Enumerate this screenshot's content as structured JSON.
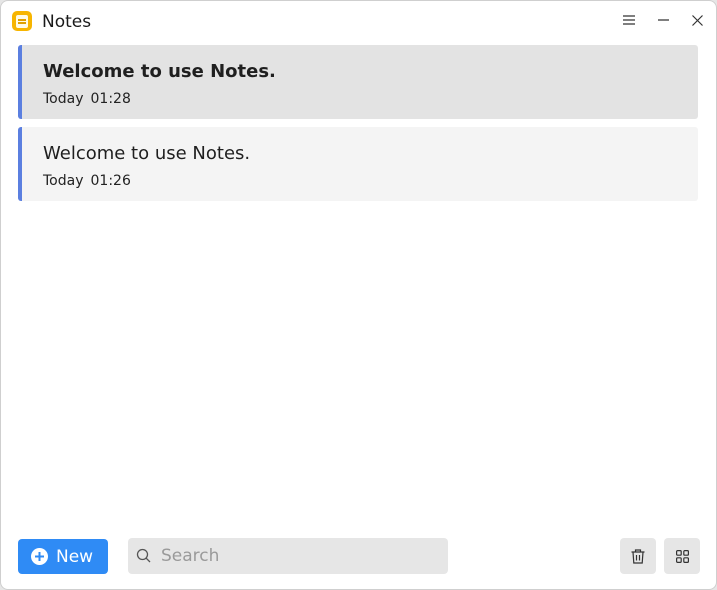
{
  "window": {
    "title": "Notes",
    "icons": {
      "app": "notes-app-icon",
      "menu": "hamburger-menu-icon",
      "minimize": "minimize-icon",
      "close": "close-icon"
    }
  },
  "notes": [
    {
      "title": "Welcome to use Notes.",
      "day": "Today",
      "time": "01:28",
      "selected": true
    },
    {
      "title": "Welcome to use Notes.",
      "day": "Today",
      "time": "01:26",
      "selected": false
    }
  ],
  "toolbar": {
    "new_label": "New",
    "new_icon": "plus-circle-icon",
    "search_placeholder": "Search",
    "search_value": "",
    "search_icon": "search-icon",
    "delete_icon": "trash-icon",
    "view_icon": "grid-view-icon"
  },
  "colors": {
    "accent": "#2f8bf5",
    "note_marker": "#5b7fe0",
    "app_icon": "#f7b500",
    "selected_note_bg": "#e3e3e3",
    "note_bg": "#f4f4f4"
  }
}
